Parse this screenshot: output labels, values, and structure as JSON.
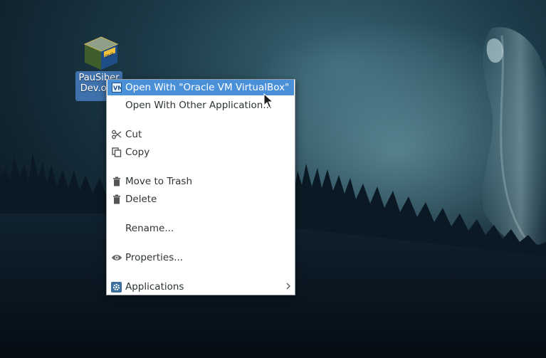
{
  "desktop": {
    "icon": {
      "name": "virtualbox-appliance-icon",
      "label_line1": "PauSiber",
      "label_line2": "Dev.ova"
    }
  },
  "context_menu": {
    "items": [
      {
        "label": "Open With \"Oracle VM VirtualBox\"",
        "icon": "virtualbox-icon",
        "selected": true
      },
      {
        "label": "Open With Other Application...",
        "icon": ""
      },
      {
        "label": "Cut",
        "icon": "scissors-icon"
      },
      {
        "label": "Copy",
        "icon": "copy-icon"
      },
      {
        "label": "Move to Trash",
        "icon": "trash-icon"
      },
      {
        "label": "Delete",
        "icon": "trash-icon"
      },
      {
        "label": "Rename...",
        "icon": ""
      },
      {
        "label": "Properties...",
        "icon": "eye-icon"
      },
      {
        "label": "Applications",
        "icon": "gear-icon",
        "submenu": true
      }
    ]
  },
  "colors": {
    "selection": "#4a90d9",
    "menu_bg": "#ffffff",
    "menu_text": "#2e3436"
  }
}
